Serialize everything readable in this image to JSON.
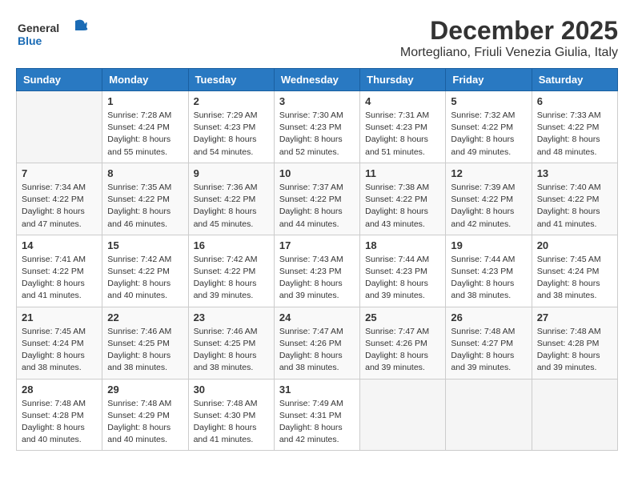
{
  "header": {
    "logo_general": "General",
    "logo_blue": "Blue",
    "month_year": "December 2025",
    "location": "Mortegliano, Friuli Venezia Giulia, Italy"
  },
  "columns": [
    "Sunday",
    "Monday",
    "Tuesday",
    "Wednesday",
    "Thursday",
    "Friday",
    "Saturday"
  ],
  "weeks": [
    [
      {
        "day": "",
        "info": ""
      },
      {
        "day": "1",
        "info": "Sunrise: 7:28 AM\nSunset: 4:24 PM\nDaylight: 8 hours\nand 55 minutes."
      },
      {
        "day": "2",
        "info": "Sunrise: 7:29 AM\nSunset: 4:23 PM\nDaylight: 8 hours\nand 54 minutes."
      },
      {
        "day": "3",
        "info": "Sunrise: 7:30 AM\nSunset: 4:23 PM\nDaylight: 8 hours\nand 52 minutes."
      },
      {
        "day": "4",
        "info": "Sunrise: 7:31 AM\nSunset: 4:23 PM\nDaylight: 8 hours\nand 51 minutes."
      },
      {
        "day": "5",
        "info": "Sunrise: 7:32 AM\nSunset: 4:22 PM\nDaylight: 8 hours\nand 49 minutes."
      },
      {
        "day": "6",
        "info": "Sunrise: 7:33 AM\nSunset: 4:22 PM\nDaylight: 8 hours\nand 48 minutes."
      }
    ],
    [
      {
        "day": "7",
        "info": "Sunrise: 7:34 AM\nSunset: 4:22 PM\nDaylight: 8 hours\nand 47 minutes."
      },
      {
        "day": "8",
        "info": "Sunrise: 7:35 AM\nSunset: 4:22 PM\nDaylight: 8 hours\nand 46 minutes."
      },
      {
        "day": "9",
        "info": "Sunrise: 7:36 AM\nSunset: 4:22 PM\nDaylight: 8 hours\nand 45 minutes."
      },
      {
        "day": "10",
        "info": "Sunrise: 7:37 AM\nSunset: 4:22 PM\nDaylight: 8 hours\nand 44 minutes."
      },
      {
        "day": "11",
        "info": "Sunrise: 7:38 AM\nSunset: 4:22 PM\nDaylight: 8 hours\nand 43 minutes."
      },
      {
        "day": "12",
        "info": "Sunrise: 7:39 AM\nSunset: 4:22 PM\nDaylight: 8 hours\nand 42 minutes."
      },
      {
        "day": "13",
        "info": "Sunrise: 7:40 AM\nSunset: 4:22 PM\nDaylight: 8 hours\nand 41 minutes."
      }
    ],
    [
      {
        "day": "14",
        "info": "Sunrise: 7:41 AM\nSunset: 4:22 PM\nDaylight: 8 hours\nand 41 minutes."
      },
      {
        "day": "15",
        "info": "Sunrise: 7:42 AM\nSunset: 4:22 PM\nDaylight: 8 hours\nand 40 minutes."
      },
      {
        "day": "16",
        "info": "Sunrise: 7:42 AM\nSunset: 4:22 PM\nDaylight: 8 hours\nand 39 minutes."
      },
      {
        "day": "17",
        "info": "Sunrise: 7:43 AM\nSunset: 4:23 PM\nDaylight: 8 hours\nand 39 minutes."
      },
      {
        "day": "18",
        "info": "Sunrise: 7:44 AM\nSunset: 4:23 PM\nDaylight: 8 hours\nand 39 minutes."
      },
      {
        "day": "19",
        "info": "Sunrise: 7:44 AM\nSunset: 4:23 PM\nDaylight: 8 hours\nand 38 minutes."
      },
      {
        "day": "20",
        "info": "Sunrise: 7:45 AM\nSunset: 4:24 PM\nDaylight: 8 hours\nand 38 minutes."
      }
    ],
    [
      {
        "day": "21",
        "info": "Sunrise: 7:45 AM\nSunset: 4:24 PM\nDaylight: 8 hours\nand 38 minutes."
      },
      {
        "day": "22",
        "info": "Sunrise: 7:46 AM\nSunset: 4:25 PM\nDaylight: 8 hours\nand 38 minutes."
      },
      {
        "day": "23",
        "info": "Sunrise: 7:46 AM\nSunset: 4:25 PM\nDaylight: 8 hours\nand 38 minutes."
      },
      {
        "day": "24",
        "info": "Sunrise: 7:47 AM\nSunset: 4:26 PM\nDaylight: 8 hours\nand 38 minutes."
      },
      {
        "day": "25",
        "info": "Sunrise: 7:47 AM\nSunset: 4:26 PM\nDaylight: 8 hours\nand 39 minutes."
      },
      {
        "day": "26",
        "info": "Sunrise: 7:48 AM\nSunset: 4:27 PM\nDaylight: 8 hours\nand 39 minutes."
      },
      {
        "day": "27",
        "info": "Sunrise: 7:48 AM\nSunset: 4:28 PM\nDaylight: 8 hours\nand 39 minutes."
      }
    ],
    [
      {
        "day": "28",
        "info": "Sunrise: 7:48 AM\nSunset: 4:28 PM\nDaylight: 8 hours\nand 40 minutes."
      },
      {
        "day": "29",
        "info": "Sunrise: 7:48 AM\nSunset: 4:29 PM\nDaylight: 8 hours\nand 40 minutes."
      },
      {
        "day": "30",
        "info": "Sunrise: 7:48 AM\nSunset: 4:30 PM\nDaylight: 8 hours\nand 41 minutes."
      },
      {
        "day": "31",
        "info": "Sunrise: 7:49 AM\nSunset: 4:31 PM\nDaylight: 8 hours\nand 42 minutes."
      },
      {
        "day": "",
        "info": ""
      },
      {
        "day": "",
        "info": ""
      },
      {
        "day": "",
        "info": ""
      }
    ]
  ]
}
